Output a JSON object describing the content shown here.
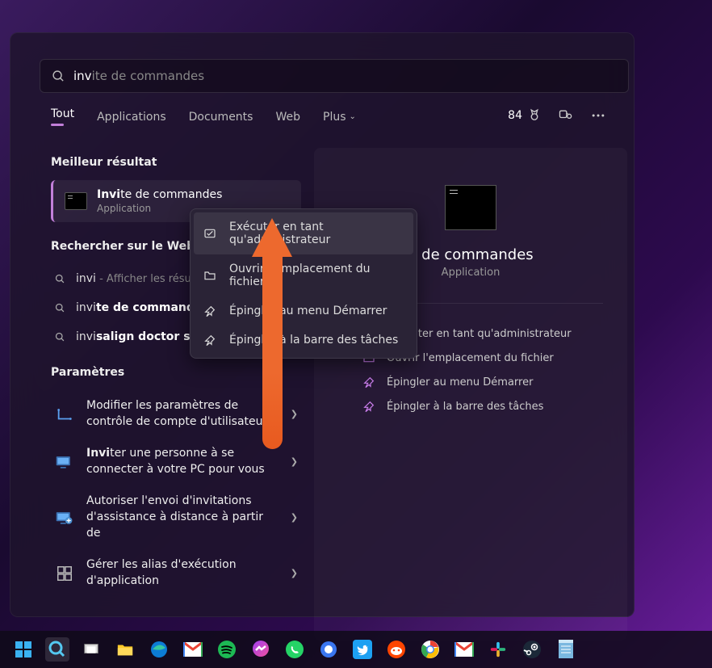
{
  "search": {
    "typed": "inv",
    "completion": "ite de commandes"
  },
  "tabs": {
    "all": "Tout",
    "apps": "Applications",
    "docs": "Documents",
    "web": "Web",
    "more": "Plus"
  },
  "rewards": {
    "points": "84"
  },
  "sections": {
    "best_match": "Meilleur résultat",
    "web_search": "Rechercher sur le Web",
    "settings": "Paramètres"
  },
  "best_match": {
    "title_bold": "Invi",
    "title_rest": "te de commandes",
    "subtitle": "Application"
  },
  "web_results": [
    {
      "prefix": "invi",
      "bold": "",
      "rest": "",
      "suffix_muted": " - Afficher les résultats W"
    },
    {
      "prefix": "invi",
      "bold": "te de commande",
      "rest": "",
      "suffix_muted": ""
    },
    {
      "prefix": "invi",
      "bold": "salign doctor site",
      "rest": "",
      "suffix_muted": ""
    }
  ],
  "settings_results": [
    {
      "icon": "uac",
      "text": "Modifier les paramètres de contrôle de compte d'utilisateur"
    },
    {
      "icon": "invite-pc",
      "text_bold": "Invi",
      "text_rest": "ter une personne à se connecter à votre PC pour vous"
    },
    {
      "icon": "remote-assist",
      "text": "Autoriser l'envoi d'invitations d'assistance à distance à partir de"
    },
    {
      "icon": "alias",
      "text": "Gérer les alias d'exécution d'application"
    }
  ],
  "preview": {
    "title_partial": "e de commandes",
    "subtitle": "Application",
    "actions": [
      "Exécuter en tant qu'administrateur",
      "Ouvrir l'emplacement du fichier",
      "Épingler au menu Démarrer",
      "Épingler à la barre des tâches"
    ]
  },
  "context_menu": [
    "Exécuter en tant qu'administrateur",
    "Ouvrir l'emplacement du fichier",
    "Épingler au menu Démarrer",
    "Épingler à la barre des tâches"
  ],
  "taskbar_icons": [
    "start",
    "search",
    "taskview",
    "explorer",
    "edge",
    "gmail",
    "spotify",
    "messenger",
    "whatsapp",
    "signal",
    "twitter",
    "reddit",
    "chrome",
    "gmail2",
    "slack",
    "steam",
    "notepad"
  ]
}
